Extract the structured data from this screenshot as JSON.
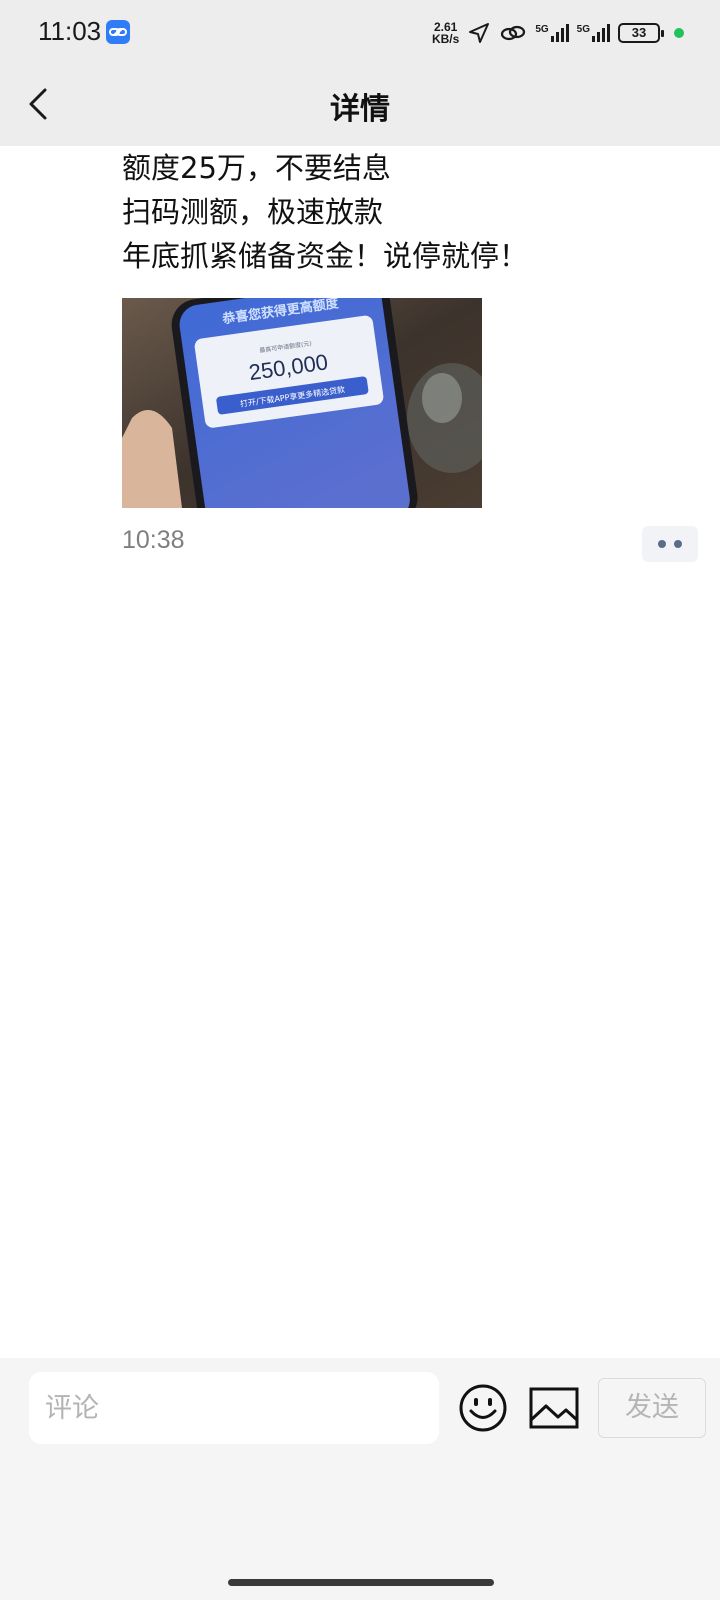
{
  "status_bar": {
    "time": "11:03",
    "net_speed_value": "2.61",
    "net_speed_unit": "KB/s",
    "sim1_label": "5G",
    "sim2_label": "5G",
    "battery": "33",
    "app_icon": "link-icon",
    "icons": [
      "location-arrow-icon",
      "hotspot-link-icon",
      "signal-icon",
      "signal-icon",
      "battery-icon"
    ]
  },
  "nav": {
    "title": "详情",
    "back_icon": "chevron-left-icon"
  },
  "post": {
    "lines": [
      "额度25万，不要结息",
      "扫码测额，极速放款",
      "年底抓紧储备资金！说停就停！"
    ],
    "image": {
      "banner_text": "恭喜您获得更高额度",
      "small_label": "最高可申请额度(元)",
      "amount": "250,000",
      "button_text": "打开/下载APP享更多精选贷款"
    },
    "time": "10:38",
    "more_icon": "more-dots-icon"
  },
  "comment": {
    "placeholder": "评论",
    "value": "",
    "emoji_icon": "emoji-icon",
    "image_icon": "image-icon",
    "send_label": "发送"
  },
  "colors": {
    "header_bg": "#ededed",
    "footer_bg": "#f5f5f5",
    "time_text": "#7f7f7f",
    "more_dots": "#5a6b8c"
  }
}
